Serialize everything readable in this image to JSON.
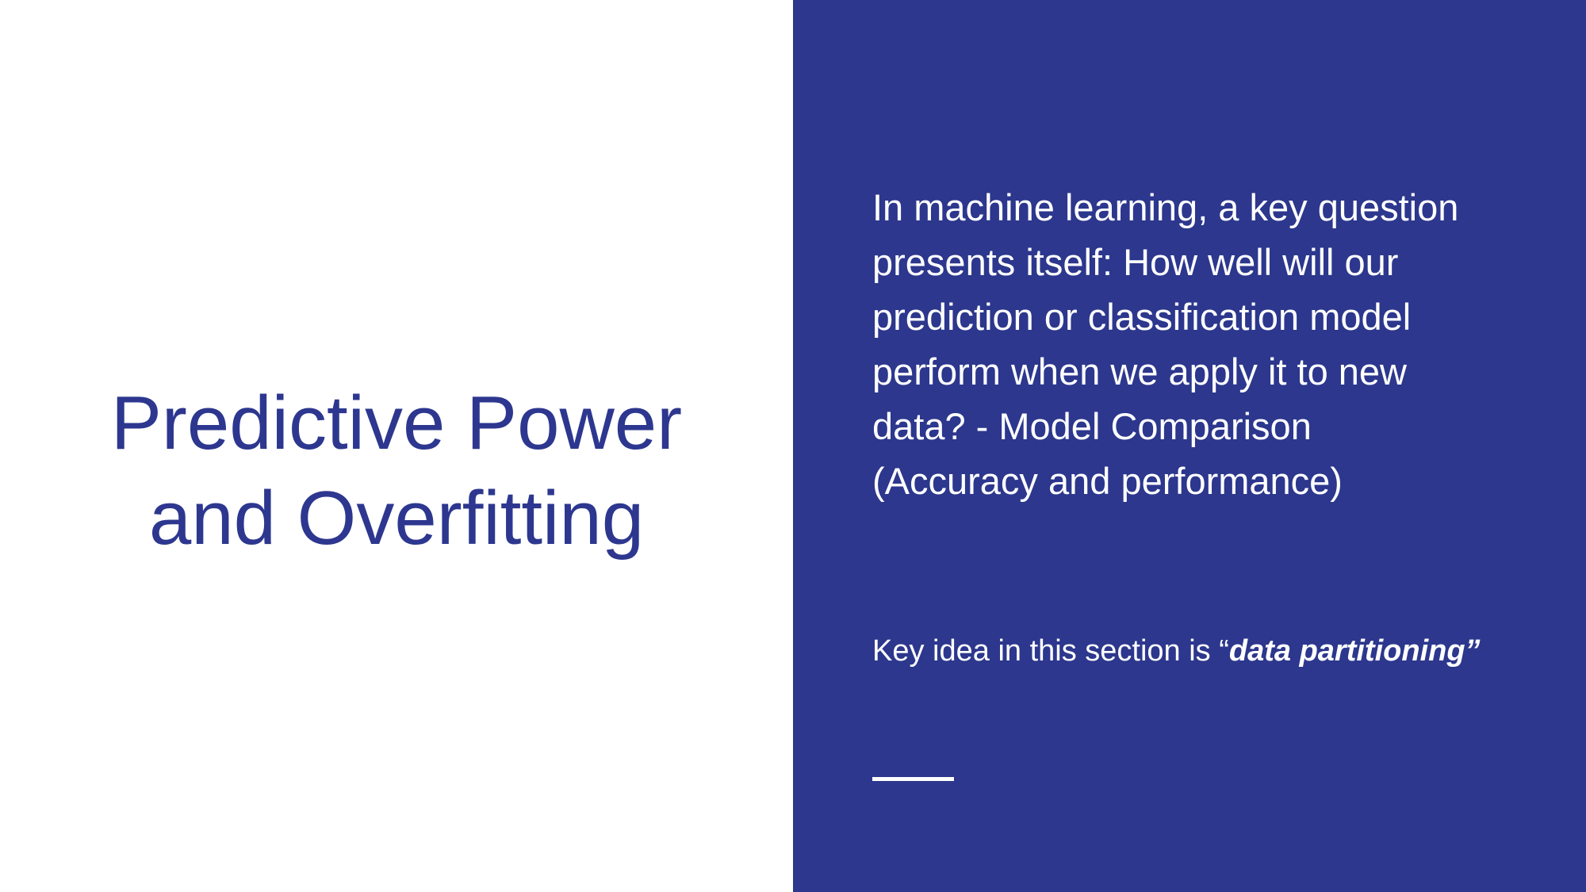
{
  "slide": {
    "title_lines": [
      "Predictive Power",
      "and Overfitting"
    ],
    "body_lines": [
      "In machine learning, a key question",
      "presents itself: How well will our",
      "prediction or classification model",
      "perform when we apply it to new",
      "data? - Model Comparison",
      "(Accuracy and performance)"
    ],
    "key_idea_prefix": "Key idea in this section is “",
    "key_idea_emphasis": "data partitioning”"
  },
  "colors": {
    "title_text": "#2d378f",
    "panel_background": "#2c378d",
    "panel_text": "#ffffff"
  }
}
